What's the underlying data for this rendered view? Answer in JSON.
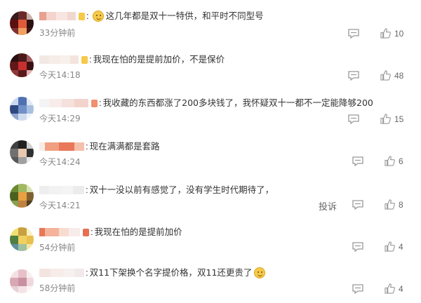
{
  "comments": [
    {
      "text": "这几年都是双十一特供，和平时不同型号",
      "time": "33分钟前",
      "likes": "10",
      "emoji": "smile"
    },
    {
      "text": "我现在怕的是提前加价，不是保价",
      "time": "今天14:18",
      "likes": "48"
    },
    {
      "text": "我收藏的东西都涨了200多块钱了，我怀疑双十一都不一定能降够200",
      "time": "今天14:29",
      "likes": "15"
    },
    {
      "text": "现在满满都是套路",
      "time": "今天14:24",
      "likes": "6"
    },
    {
      "text": "双十一没以前有感觉了，没有学生时代期待了，",
      "time": "今天14:21",
      "likes": "8",
      "report": "投诉"
    },
    {
      "text": "我现在怕的是提前加价",
      "time": "54分钟前",
      "likes": "4"
    },
    {
      "text": "双11下架换个名字提价格，双11还更贵了",
      "time": "58分钟前",
      "likes": "4",
      "emoji": "worried"
    }
  ],
  "icons": {
    "reply": "comment-icon",
    "like": "thumbs-up-icon"
  },
  "colors": {
    "text": "#333333",
    "muted": "#888888",
    "icon": "#999999"
  }
}
